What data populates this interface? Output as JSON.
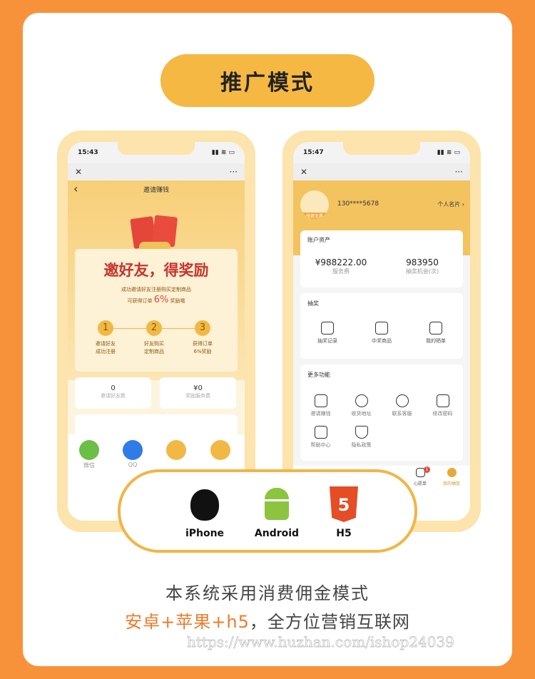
{
  "title": "推广模式",
  "left_phone": {
    "time": "15:43",
    "close": "✕",
    "more": "···",
    "back": "‹",
    "page_title": "邀请赚钱",
    "headline": "邀好友，得奖励",
    "desc1": "成功邀请好友注册购买定制商品",
    "desc2_pre": "可获得订单",
    "desc2_pct": "6%",
    "desc2_post": "奖励哦",
    "steps": [
      {
        "num": "1",
        "l1": "邀请好友",
        "l2": "成功注册"
      },
      {
        "num": "2",
        "l1": "好友购买",
        "l2": "定制商品"
      },
      {
        "num": "3",
        "l1": "获得订单",
        "l2": "6%奖励"
      }
    ],
    "stats": [
      {
        "value": "0",
        "label": "邀请好友数"
      },
      {
        "value": "¥0",
        "label": "奖励服务费"
      }
    ],
    "share": [
      {
        "label": "微信",
        "icon": "wechat-icon",
        "color": "#6cbf45"
      },
      {
        "label": "QQ",
        "icon": "qq-icon",
        "color": "#2f7be8"
      },
      {
        "label": "",
        "icon": "poster-icon",
        "color": "#f1b944"
      },
      {
        "label": "",
        "icon": "qrcode-icon",
        "color": "#f1b944"
      }
    ]
  },
  "right_phone": {
    "time": "15:47",
    "close": "✕",
    "more": "···",
    "avatar_text": "悦君无界",
    "phone": "130****5678",
    "card_link": "个人名片 ›",
    "assets_title": "账户资产",
    "assets": [
      {
        "value": "¥988222.00",
        "label": "服务费"
      },
      {
        "value": "983950",
        "label": "抽奖机会(次)"
      }
    ],
    "lottery_title": "抽奖",
    "lottery": [
      "抽奖记录",
      "中奖商品",
      "我的晒单"
    ],
    "more_title": "更多功能",
    "more_items": [
      "邀请赚钱",
      "收货地址",
      "联系客服",
      "修改密码",
      "帮助中心",
      "隐私政策"
    ],
    "tabs": [
      {
        "label": "心愿单",
        "badge": "1"
      },
      {
        "label": "我的抽奖"
      }
    ]
  },
  "platforms": [
    "iPhone",
    "Android",
    "H5"
  ],
  "bottom_line1": "本系统采用消费佣金模式",
  "bottom_line2_highlight": "安卓+苹果+h5",
  "bottom_line2_rest": "，全方位营销互联网",
  "watermark": "https://www.huzhan.com/ishop24039",
  "colors": {
    "background": "#f8923a",
    "accent": "#f5b843",
    "highlight": "#f07a2a",
    "headline_red": "#c9332a"
  }
}
